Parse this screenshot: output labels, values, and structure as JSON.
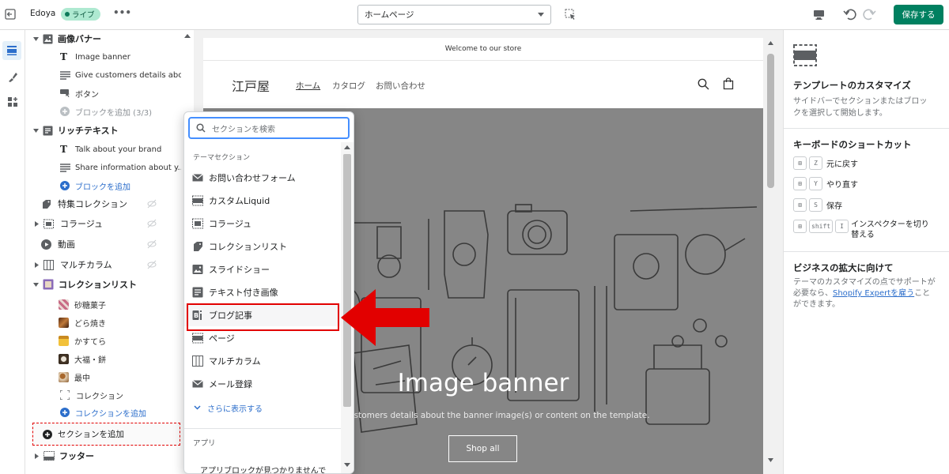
{
  "topbar": {
    "store_name": "Edoya",
    "status_badge": "ライブ",
    "more_label": "•••",
    "page_select": "ホームページ",
    "save_label": "保存する"
  },
  "sidebar": {
    "sections": [
      {
        "label": "画像バナー"
      },
      {
        "label": "リッチテキスト"
      },
      {
        "label": "特集コレクション"
      },
      {
        "label": "コラージュ"
      },
      {
        "label": "動画"
      },
      {
        "label": "マルチカラム"
      },
      {
        "label": "コレクションリスト"
      },
      {
        "label": "フッター"
      }
    ],
    "image_banner_blocks": [
      "Image banner",
      "Give customers details abo...",
      "ボタン",
      "ブロックを追加 (3/3)"
    ],
    "rich_text_blocks": [
      "Talk about your brand",
      "Share information about y...",
      "ブロックを追加"
    ],
    "collection_blocks": [
      "砂糖菓子",
      "どら焼き",
      "かすてら",
      "大福・餅",
      "最中",
      "コレクション",
      "コレクションを追加"
    ],
    "add_section": "セクションを追加"
  },
  "preview": {
    "announcement": "Welcome to our store",
    "logo": "江戸屋",
    "nav": [
      "ホーム",
      "カタログ",
      "お問い合わせ"
    ],
    "banner_title": "Image banner",
    "banner_text": "ustomers details about the banner image(s) or content on the template.",
    "banner_button": "Shop all"
  },
  "popup": {
    "search_placeholder": "セクションを検索",
    "theme_sections_header": "テーマセクション",
    "items": [
      "お問い合わせフォーム",
      "カスタムLiquid",
      "コラージュ",
      "コレクションリスト",
      "スライドショー",
      "テキスト付き画像",
      "ブログ記事",
      "ページ",
      "マルチカラム",
      "メール登録"
    ],
    "show_more": "さらに表示する",
    "apps_header": "アプリ",
    "apps_text": "アプリブロックが見つかりませんで"
  },
  "right_panel": {
    "customize_title": "テンプレートのカスタマイズ",
    "customize_text": "サイドバーでセクションまたはブロックを選択して開始します。",
    "shortcuts_title": "キーボードのショートカット",
    "shortcuts": [
      {
        "key": "Z",
        "label": "元に戻す"
      },
      {
        "key": "Y",
        "label": "やり直す"
      },
      {
        "key": "S",
        "label": "保存"
      },
      {
        "key": "I",
        "label": "インスペクターを切り替える",
        "extra": "shift"
      }
    ],
    "grow_title": "ビジネスの拡大に向けて",
    "grow_text": "テーマのカスタマイズの点でサポートが必要なら、",
    "grow_link": "Shopify Expertを雇う",
    "grow_tail": "ことができます。"
  },
  "colors": {
    "accent_green": "#008060",
    "badge_bg": "#aee9d1",
    "link_blue": "#2c6ecb",
    "highlight_red": "#e20000"
  }
}
